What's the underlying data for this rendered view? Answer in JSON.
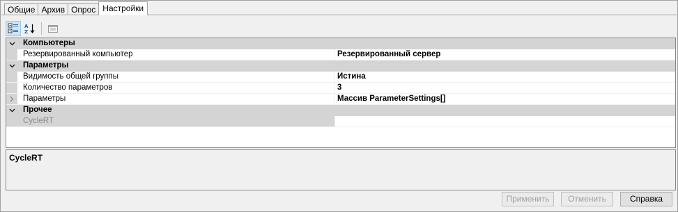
{
  "tabs": [
    {
      "label": "Общие",
      "active": false
    },
    {
      "label": "Архив",
      "active": false
    },
    {
      "label": "Опрос",
      "active": false
    },
    {
      "label": "Настройки",
      "active": true
    }
  ],
  "toolbar": {
    "icons": [
      "categorized-icon",
      "alphabetical-sort-icon",
      "property-pages-icon"
    ]
  },
  "grid": {
    "categories": [
      {
        "label": "Компьютеры",
        "rows": [
          {
            "name": "Резервированный компьютер",
            "value": "Резервированный сервер",
            "expandable": false,
            "disabled": false
          }
        ]
      },
      {
        "label": "Параметры",
        "rows": [
          {
            "name": "Видимость общей группы",
            "value": "Истина",
            "expandable": false,
            "disabled": false
          },
          {
            "name": "Количество параметров",
            "value": "3",
            "expandable": false,
            "disabled": false
          },
          {
            "name": "Параметры",
            "value": "Массив ParameterSettings[]",
            "expandable": true,
            "disabled": false
          }
        ]
      },
      {
        "label": "Прочее",
        "rows": [
          {
            "name": "CycleRT",
            "value": "",
            "expandable": false,
            "disabled": true
          }
        ]
      }
    ]
  },
  "description": {
    "title": "CycleRT"
  },
  "buttons": {
    "apply": "Применить",
    "cancel": "Отменить",
    "help": "Справка"
  }
}
